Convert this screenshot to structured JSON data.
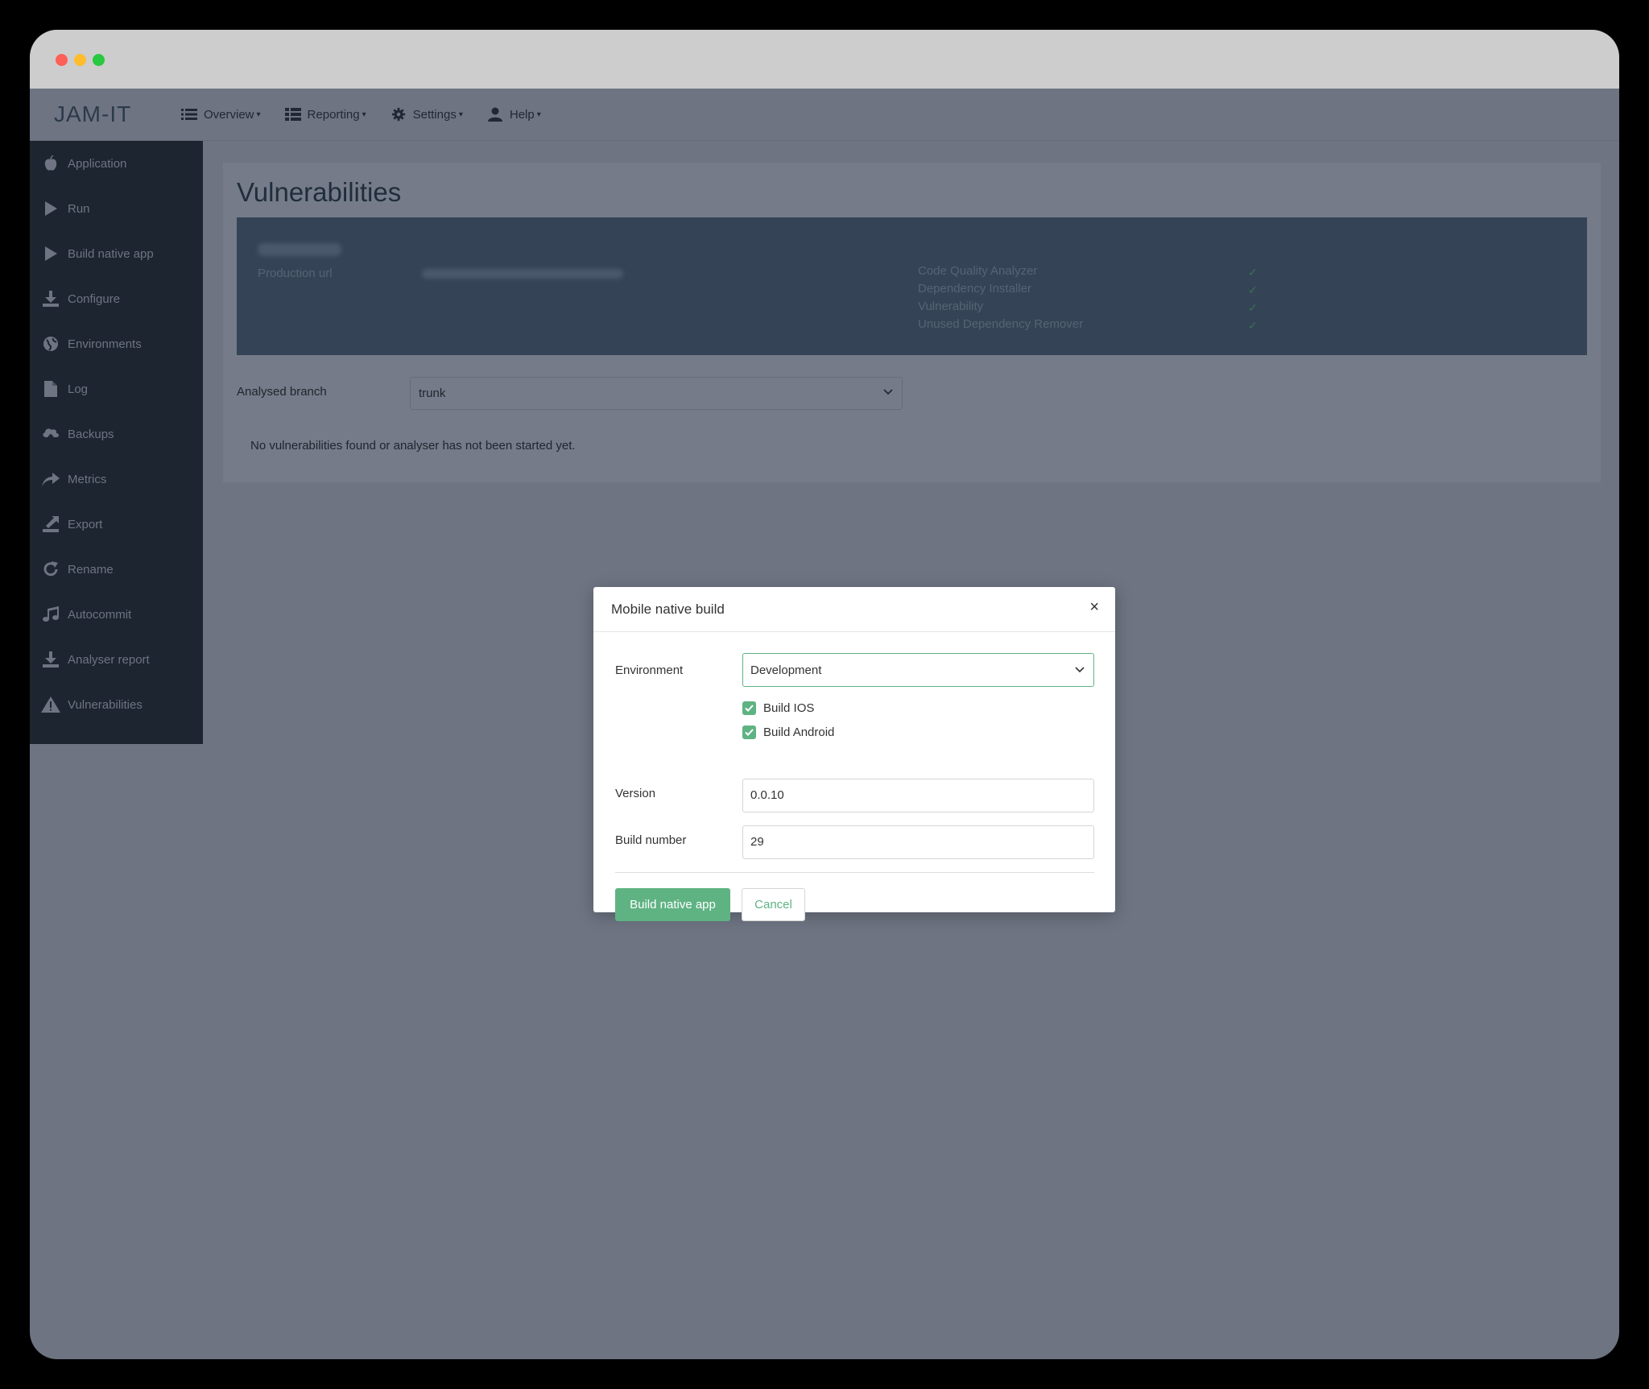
{
  "window": {
    "controls": [
      "close",
      "minimize",
      "zoom"
    ]
  },
  "navbar": {
    "logo": "JAM-IT",
    "items": [
      {
        "label": "Overview",
        "icon": "list-icon"
      },
      {
        "label": "Reporting",
        "icon": "table-icon"
      },
      {
        "label": "Settings",
        "icon": "gear-icon"
      },
      {
        "label": "Help",
        "icon": "user-icon"
      }
    ],
    "caret": "▾"
  },
  "sidebar": {
    "items": [
      {
        "label": "Application",
        "icon": "apple-icon"
      },
      {
        "label": "Run",
        "icon": "play-icon"
      },
      {
        "label": "Build native app",
        "icon": "play-icon"
      },
      {
        "label": "Configure",
        "icon": "download-icon"
      },
      {
        "label": "Environments",
        "icon": "globe-icon"
      },
      {
        "label": "Log",
        "icon": "file-icon"
      },
      {
        "label": "Backups",
        "icon": "cloud-upload-icon"
      },
      {
        "label": "Metrics",
        "icon": "share-arrow-icon"
      },
      {
        "label": "Export",
        "icon": "export-icon"
      },
      {
        "label": "Rename",
        "icon": "refresh-icon"
      },
      {
        "label": "Autocommit",
        "icon": "music-icon"
      },
      {
        "label": "Analyser report",
        "icon": "download-icon"
      },
      {
        "label": "Vulnerabilities",
        "icon": "warning-icon"
      }
    ]
  },
  "main": {
    "title": "Vulnerabilities",
    "banner": {
      "production_url_label": "Production url",
      "checks": [
        {
          "label": "Code Quality Analyzer",
          "mark": "✓"
        },
        {
          "label": "Dependency Installer",
          "mark": "✓"
        },
        {
          "label": "Vulnerability",
          "mark": "✓"
        },
        {
          "label": "Unused Dependency Remover",
          "mark": "✓"
        }
      ]
    },
    "branch": {
      "label": "Analysed branch",
      "value": "trunk"
    },
    "message": "No vulnerabilities found or analyser has not been started yet."
  },
  "modal": {
    "title": "Mobile native build",
    "close": "×",
    "environment": {
      "label": "Environment",
      "value": "Development"
    },
    "build_ios": {
      "label": "Build IOS",
      "checked": true
    },
    "build_android": {
      "label": "Build Android",
      "checked": true
    },
    "version": {
      "label": "Version",
      "value": "0.0.10"
    },
    "build_number": {
      "label": "Build number",
      "value": "29"
    },
    "submit_label": "Build native app",
    "cancel_label": "Cancel"
  },
  "colors": {
    "accent": "#5fb383",
    "sidebar_bg": "#1d2530",
    "banner_bg": "#344456",
    "overlay": "#6e7482"
  }
}
